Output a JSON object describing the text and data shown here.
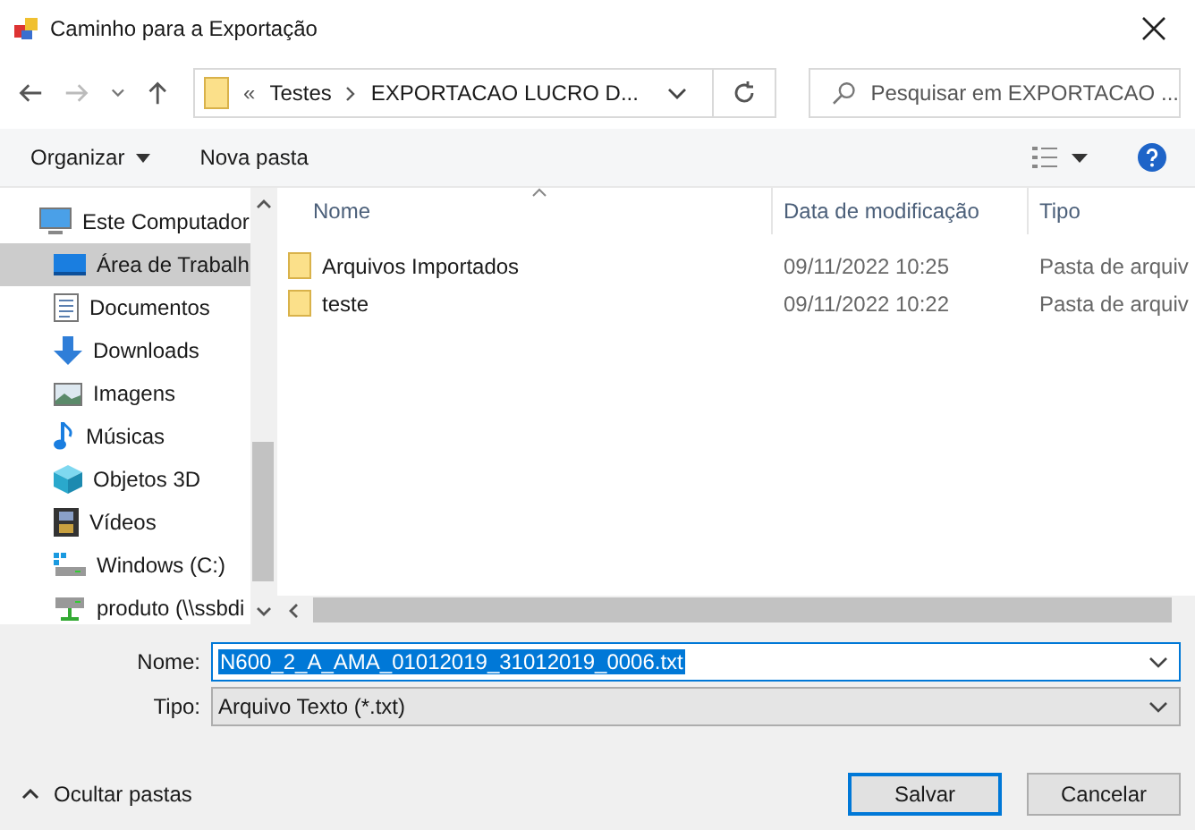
{
  "window": {
    "title": "Caminho para a Exportação"
  },
  "nav": {
    "address": {
      "prefix": "«",
      "crumbs": [
        "Testes",
        "EXPORTACAO LUCRO D..."
      ]
    },
    "search": {
      "placeholder": "Pesquisar em EXPORTACAO ..."
    }
  },
  "toolbar": {
    "organize": "Organizar",
    "new_folder": "Nova pasta"
  },
  "sidebar": {
    "items": [
      {
        "label": "Este Computador",
        "kind": "computer",
        "selected": false,
        "children": [
          {
            "label": "Área de Trabalh",
            "kind": "desktop",
            "selected": true
          },
          {
            "label": "Documentos",
            "kind": "documents",
            "selected": false
          },
          {
            "label": "Downloads",
            "kind": "downloads",
            "selected": false
          },
          {
            "label": "Imagens",
            "kind": "images",
            "selected": false
          },
          {
            "label": "Músicas",
            "kind": "music",
            "selected": false
          },
          {
            "label": "Objetos 3D",
            "kind": "objects3d",
            "selected": false
          },
          {
            "label": "Vídeos",
            "kind": "videos",
            "selected": false
          },
          {
            "label": "Windows (C:)",
            "kind": "drive",
            "selected": false
          },
          {
            "label": "produto (\\\\ssbdi",
            "kind": "network",
            "selected": false
          }
        ]
      }
    ]
  },
  "table": {
    "columns": [
      "Nome",
      "Data de modificação",
      "Tipo"
    ],
    "rows": [
      {
        "name": "Arquivos Importados",
        "date": "09/11/2022 10:25",
        "type": "Pasta de arquiv"
      },
      {
        "name": "teste",
        "date": "09/11/2022 10:22",
        "type": "Pasta de arquiv"
      }
    ]
  },
  "form": {
    "name_label": "Nome:",
    "name_value": "N600_2_A_AMA_01012019_31012019_0006.txt",
    "type_label": "Tipo:",
    "type_value": "Arquivo Texto (*.txt)"
  },
  "footer": {
    "hide_folders": "Ocultar pastas",
    "buttons": [
      {
        "label": "Salvar",
        "default": true
      },
      {
        "label": "Cancelar",
        "default": false
      }
    ]
  }
}
